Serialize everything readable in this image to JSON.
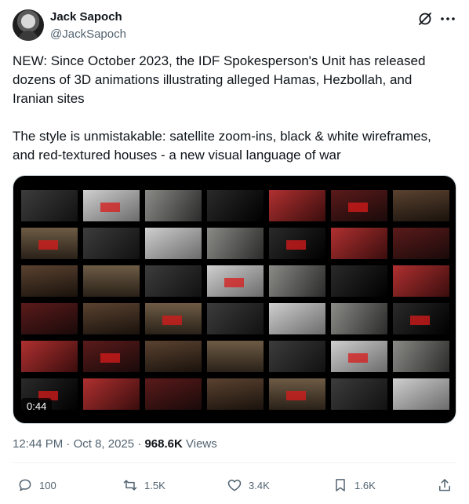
{
  "author": {
    "display_name": "Jack Sapoch",
    "handle": "@JackSapoch",
    "avatar_icon": "user-avatar"
  },
  "header_icons": {
    "grok": "grok-icon",
    "more": "more-options-icon"
  },
  "tweet": {
    "paragraphs": [
      "NEW: Since October 2023, the IDF Spokesperson's Unit has released dozens of 3D animations illustrating alleged Hamas, Hezbollah, and Iranian sites",
      "The style is unmistakable: satellite zoom-ins, black & white wireframes, and red-textured houses - a new visual language of war"
    ]
  },
  "media": {
    "type": "video",
    "duration": "0:44",
    "thumbnail_rows": 6,
    "thumbnail_cols": 7
  },
  "meta": {
    "time": "12:44 PM",
    "date": "Oct 8, 2025",
    "views_count": "968.6K",
    "views_label": "Views"
  },
  "actions": {
    "replies": "100",
    "reposts": "1.5K",
    "likes": "3.4K",
    "bookmarks": "1.6K"
  },
  "colors": {
    "text": "#0f1419",
    "secondary": "#536471",
    "media_bg": "#000000",
    "accent_red": "#d81b1b"
  }
}
